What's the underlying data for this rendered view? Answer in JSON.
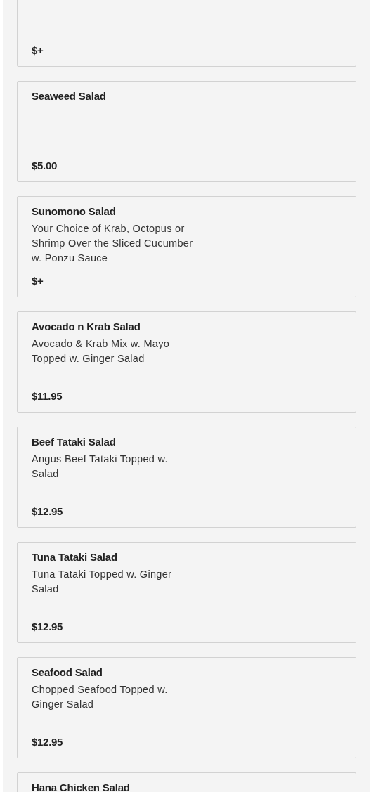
{
  "menu_items": [
    {
      "price": "$+"
    },
    {
      "name": "Seaweed Salad",
      "price": "$5.00"
    },
    {
      "name": "Sunomono Salad",
      "description": "Your Choice of Krab, Octopus or Shrimp Over the Sliced Cucumber w. Ponzu Sauce",
      "price": "$+"
    },
    {
      "name": "Avocado n Krab Salad",
      "description": "Avocado & Krab Mix w. Mayo Topped w. Ginger Salad",
      "price": "$11.95"
    },
    {
      "name": "Beef Tataki Salad",
      "description": "Angus Beef Tataki Topped w. Salad",
      "price": "$12.95"
    },
    {
      "name": "Tuna Tataki Salad",
      "description": "Tuna Tataki Topped w. Ginger Salad",
      "price": "$12.95"
    },
    {
      "name": "Seafood Salad",
      "description": "Chopped Seafood Topped w. Ginger Salad",
      "price": "$12.95"
    },
    {
      "name": "Hana Chicken Salad"
    }
  ]
}
